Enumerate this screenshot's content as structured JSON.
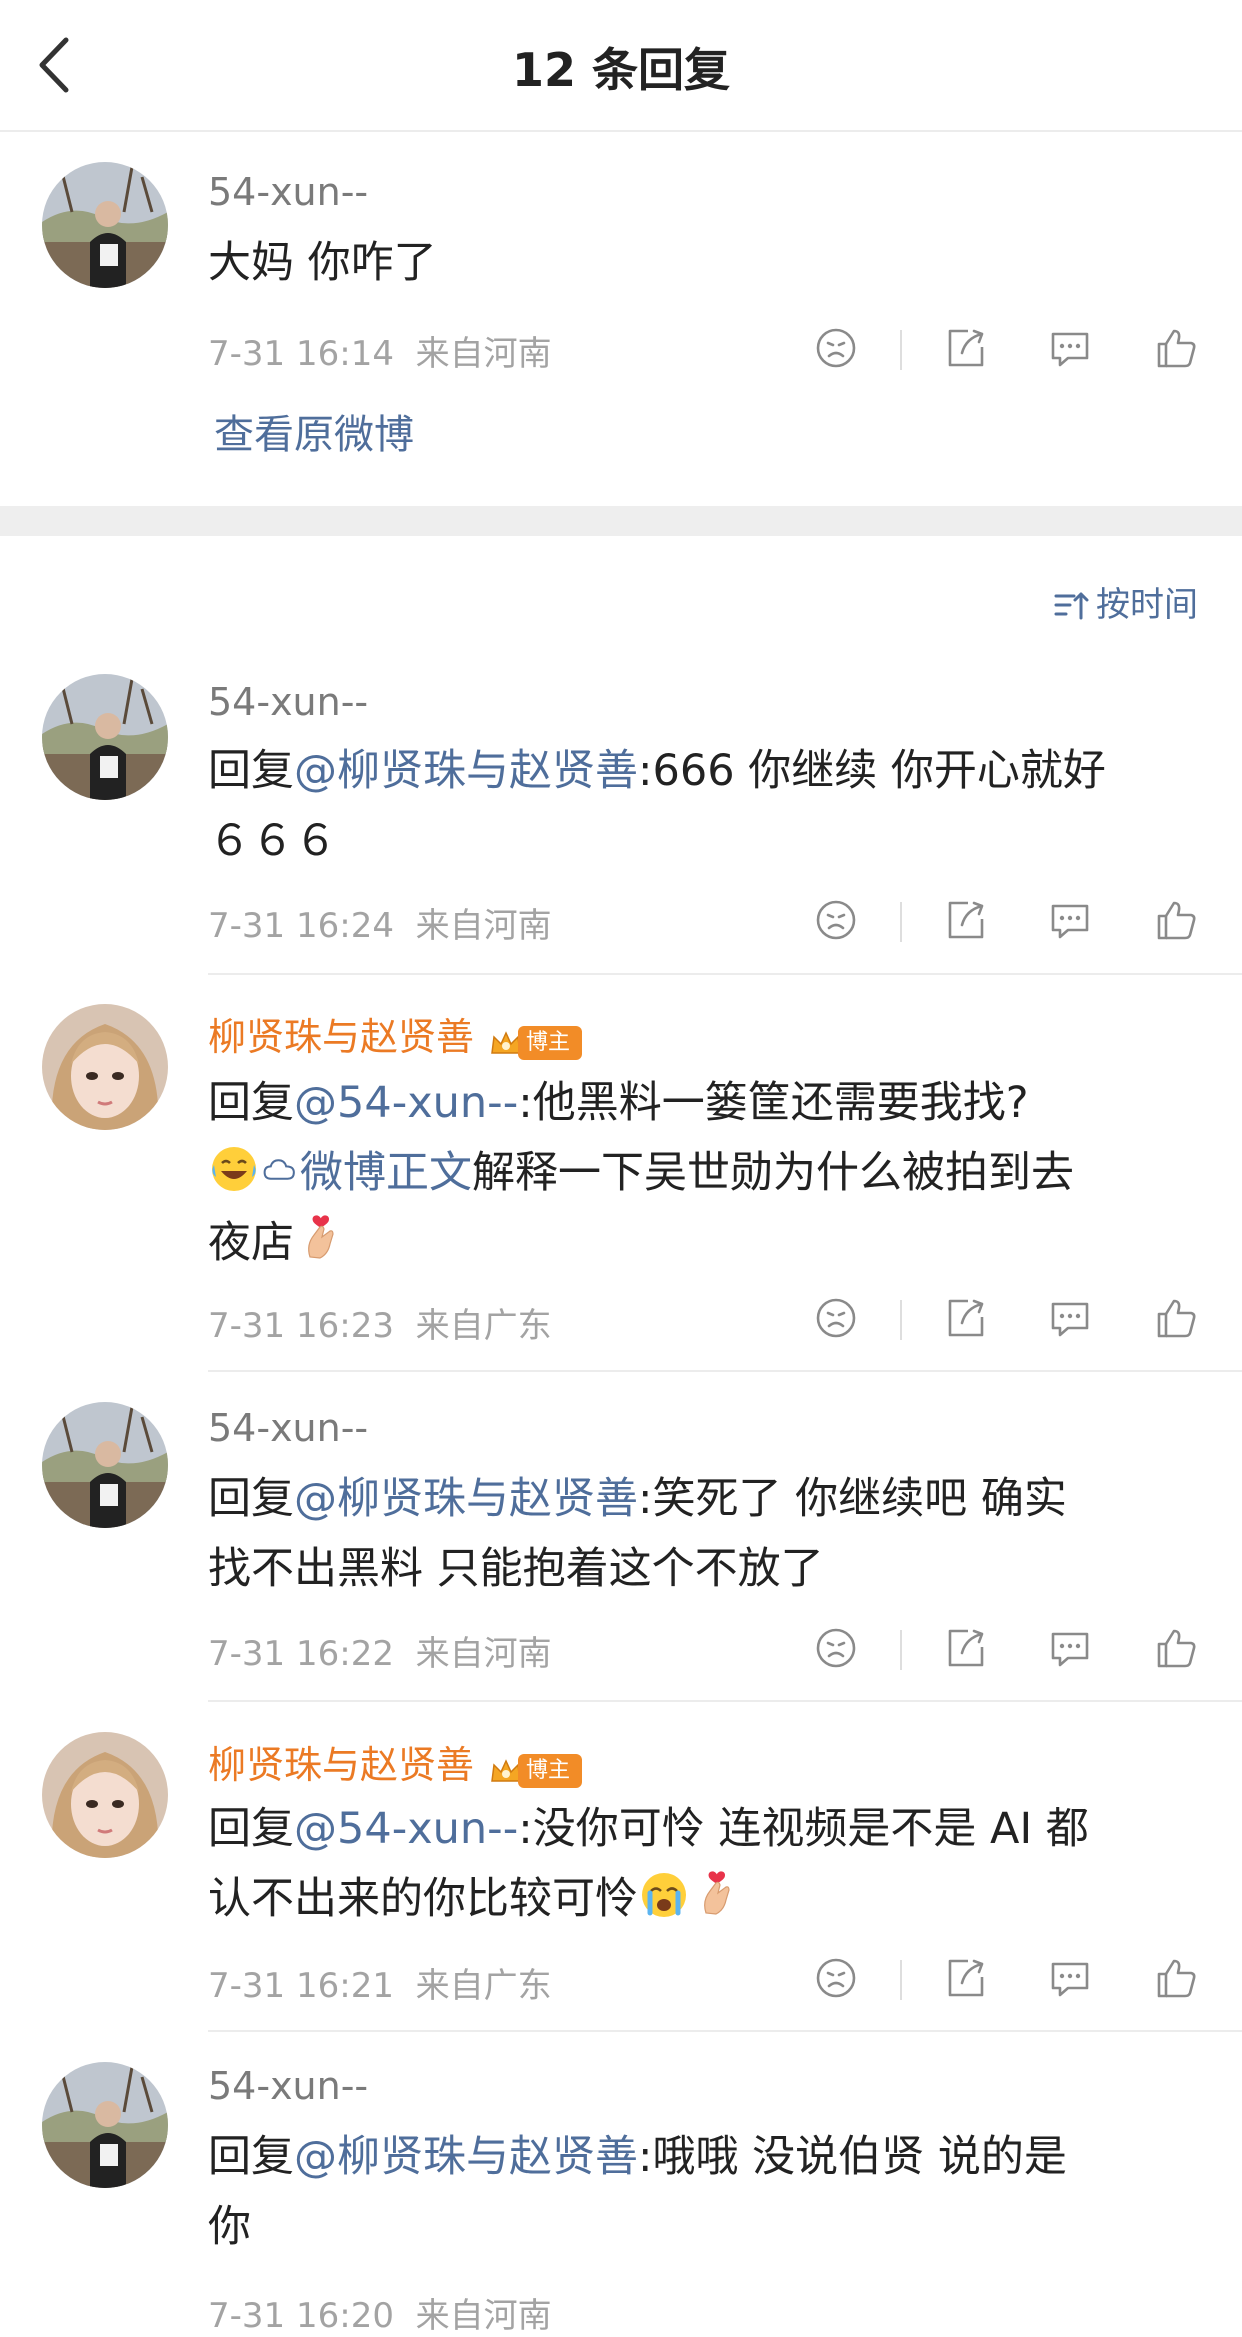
{
  "header": {
    "title": "12 条回复"
  },
  "root": {
    "user": "54-xun--",
    "text": "大妈 你咋了",
    "time": "7-31 16:14",
    "location": "来自河南",
    "view_original": "查看原微博"
  },
  "sort": {
    "label": "按时间"
  },
  "badge": {
    "label": "博主"
  },
  "replies": [
    {
      "user": "54-xun--",
      "prefix": "回复",
      "mention": "@柳贤珠与赵贤善",
      "body": ":666 你继续 你开心就好",
      "line2": "６６６",
      "time": "7-31 16:24",
      "location": "来自河南"
    },
    {
      "user": "柳贤珠与赵贤善",
      "prefix": "回复",
      "mention": "@54-xun--",
      "body": ":他黑料一篓筐还需要我找?",
      "link": "微博正文",
      "body2": "解释一下吴世勋为什么被拍到去",
      "line3": "夜店",
      "time": "7-31 16:23",
      "location": "来自广东"
    },
    {
      "user": "54-xun--",
      "prefix": "回复",
      "mention": "@柳贤珠与赵贤善",
      "body": ":笑死了 你继续吧 确实",
      "line2": "找不出黑料 只能抱着这个不放了",
      "time": "7-31 16:22",
      "location": "来自河南"
    },
    {
      "user": "柳贤珠与赵贤善",
      "prefix": "回复",
      "mention": "@54-xun--",
      "body": ":没你可怜 连视频是不是 AI 都",
      "line2": "认不出来的你比较可怜",
      "time": "7-31 16:21",
      "location": "来自广东"
    },
    {
      "user": "54-xun--",
      "prefix": "回复",
      "mention": "@柳贤珠与赵贤善",
      "body": ":哦哦 没说伯贤 说的是",
      "line2": "你",
      "time": "7-31 16:20",
      "location": "来自河南"
    }
  ],
  "icons": [
    "back-icon",
    "dislike-icon",
    "share-icon",
    "comment-icon",
    "like-icon",
    "sort-icon",
    "crown-icon"
  ],
  "colors": {
    "mention": "#4f6e9b",
    "op_name": "#eb7a24",
    "badge": "#f28c27",
    "meta": "#a3a3a3"
  }
}
